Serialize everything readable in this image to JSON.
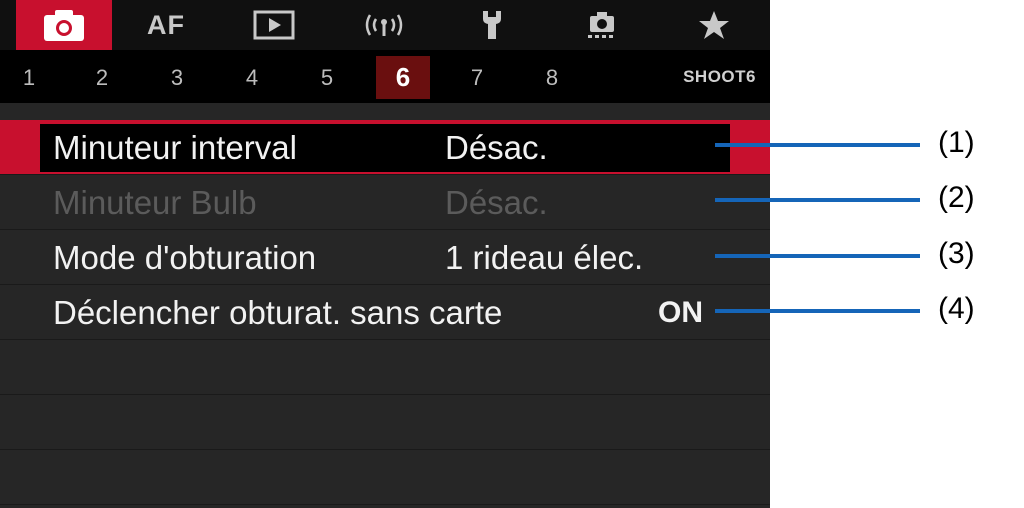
{
  "tabs": [
    {
      "name": "tab-shooting",
      "icon": "camera-icon",
      "active": true
    },
    {
      "name": "tab-af",
      "label": "AF"
    },
    {
      "name": "tab-playback",
      "icon": "play-icon"
    },
    {
      "name": "tab-wireless",
      "icon": "wireless-icon"
    },
    {
      "name": "tab-setup",
      "icon": "wrench-icon"
    },
    {
      "name": "tab-custom",
      "icon": "custom-functions-icon"
    },
    {
      "name": "tab-my-menu",
      "icon": "star-icon"
    }
  ],
  "pages": [
    "1",
    "2",
    "3",
    "4",
    "5",
    "6",
    "7",
    "8"
  ],
  "active_page": "6",
  "page_label": "SHOOT6",
  "menu": [
    {
      "label": "Minuteur interval",
      "value": "Désac.",
      "state": "selected"
    },
    {
      "label": "Minuteur Bulb",
      "value": "Désac.",
      "state": "disabled"
    },
    {
      "label": "Mode d'obturation",
      "value": "1 rideau élec.",
      "state": "normal"
    },
    {
      "label": "Déclencher obturat. sans carte",
      "value": "ON",
      "state": "normal"
    }
  ],
  "callouts": [
    "(1)",
    "(2)",
    "(3)",
    "(4)"
  ],
  "colors": {
    "accent": "#c8102e",
    "leader": "#1565b8",
    "background": "#262626"
  }
}
